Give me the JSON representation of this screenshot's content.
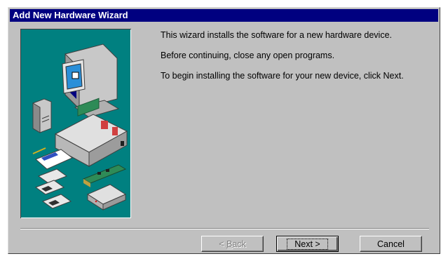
{
  "window": {
    "title": "Add New Hardware Wizard"
  },
  "body": {
    "paragraphs": [
      "This wizard installs the software for a new hardware device.",
      "Before continuing, close any open programs.",
      "To begin installing the software for your new device, click Next."
    ]
  },
  "buttons": {
    "back": {
      "mnemonic": "B",
      "rest": "ack",
      "prefix": "< ",
      "state": "disabled"
    },
    "next": {
      "label": "Next >",
      "state": "default"
    },
    "cancel": {
      "label": "Cancel"
    }
  },
  "art": {
    "icons": [
      "computer-monitor-icon",
      "speaker-icon",
      "computer-case-icon",
      "documents-icon",
      "floppy-disks-icon",
      "expansion-card-icon",
      "modem-icon"
    ]
  },
  "colors": {
    "titlebar": "#000080",
    "panel": "#008080",
    "face": "#c0c0c0"
  }
}
